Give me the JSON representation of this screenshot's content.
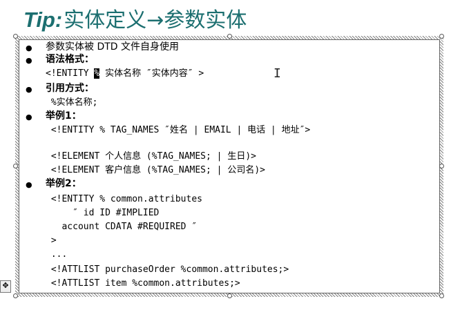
{
  "title": {
    "tip": "Tip:",
    "text": "实体定义→参数实体"
  },
  "lines": [
    {
      "bullet": true,
      "bold": false,
      "mono": false,
      "text": "参数实体被 DTD 文件自身使用"
    },
    {
      "bullet": true,
      "bold": true,
      "mono": false,
      "text": "语法格式："
    },
    {
      "bullet": false,
      "bold": false,
      "mono": true,
      "pre": "<!ENTITY ",
      "cursor": "%",
      "post": " 实体名称 ″实体内容″ >"
    },
    {
      "bullet": true,
      "bold": true,
      "mono": false,
      "text": "引用方式："
    },
    {
      "bullet": false,
      "bold": false,
      "mono": true,
      "text": " %实体名称;"
    },
    {
      "bullet": true,
      "bold": true,
      "mono": false,
      "text": "举例1："
    },
    {
      "bullet": false,
      "bold": false,
      "mono": true,
      "text": " <!ENTITY % TAG_NAMES ″姓名 | EMAIL | 电话 | 地址″>"
    },
    {
      "bullet": false,
      "bold": false,
      "mono": true,
      "text": ""
    },
    {
      "bullet": false,
      "bold": false,
      "mono": true,
      "text": " <!ELEMENT 个人信息 (%TAG_NAMES; | 生日)>"
    },
    {
      "bullet": false,
      "bold": false,
      "mono": true,
      "text": " <!ELEMENT 客户信息 (%TAG_NAMES; | 公司名)>"
    },
    {
      "bullet": true,
      "bold": true,
      "mono": false,
      "text": "举例2："
    },
    {
      "bullet": false,
      "bold": false,
      "mono": true,
      "text": " <!ENTITY % common.attributes"
    },
    {
      "bullet": false,
      "bold": false,
      "mono": true,
      "text": "     ″ id ID #IMPLIED"
    },
    {
      "bullet": false,
      "bold": false,
      "mono": true,
      "text": "   account CDATA #REQUIRED ″"
    },
    {
      "bullet": false,
      "bold": false,
      "mono": true,
      "text": " >"
    },
    {
      "bullet": false,
      "bold": false,
      "mono": true,
      "text": " ..."
    },
    {
      "bullet": false,
      "bold": false,
      "mono": true,
      "text": " <!ATTLIST purchaseOrder %common.attributes;>"
    },
    {
      "bullet": false,
      "bold": false,
      "mono": true,
      "text": " <!ATTLIST item %common.attributes;>"
    }
  ],
  "colors": {
    "title": "#1c6f70",
    "frame": "#7f7f7f"
  },
  "icons": {
    "cursor": "text-cursor-icon",
    "anchor": "table-move-icon"
  }
}
